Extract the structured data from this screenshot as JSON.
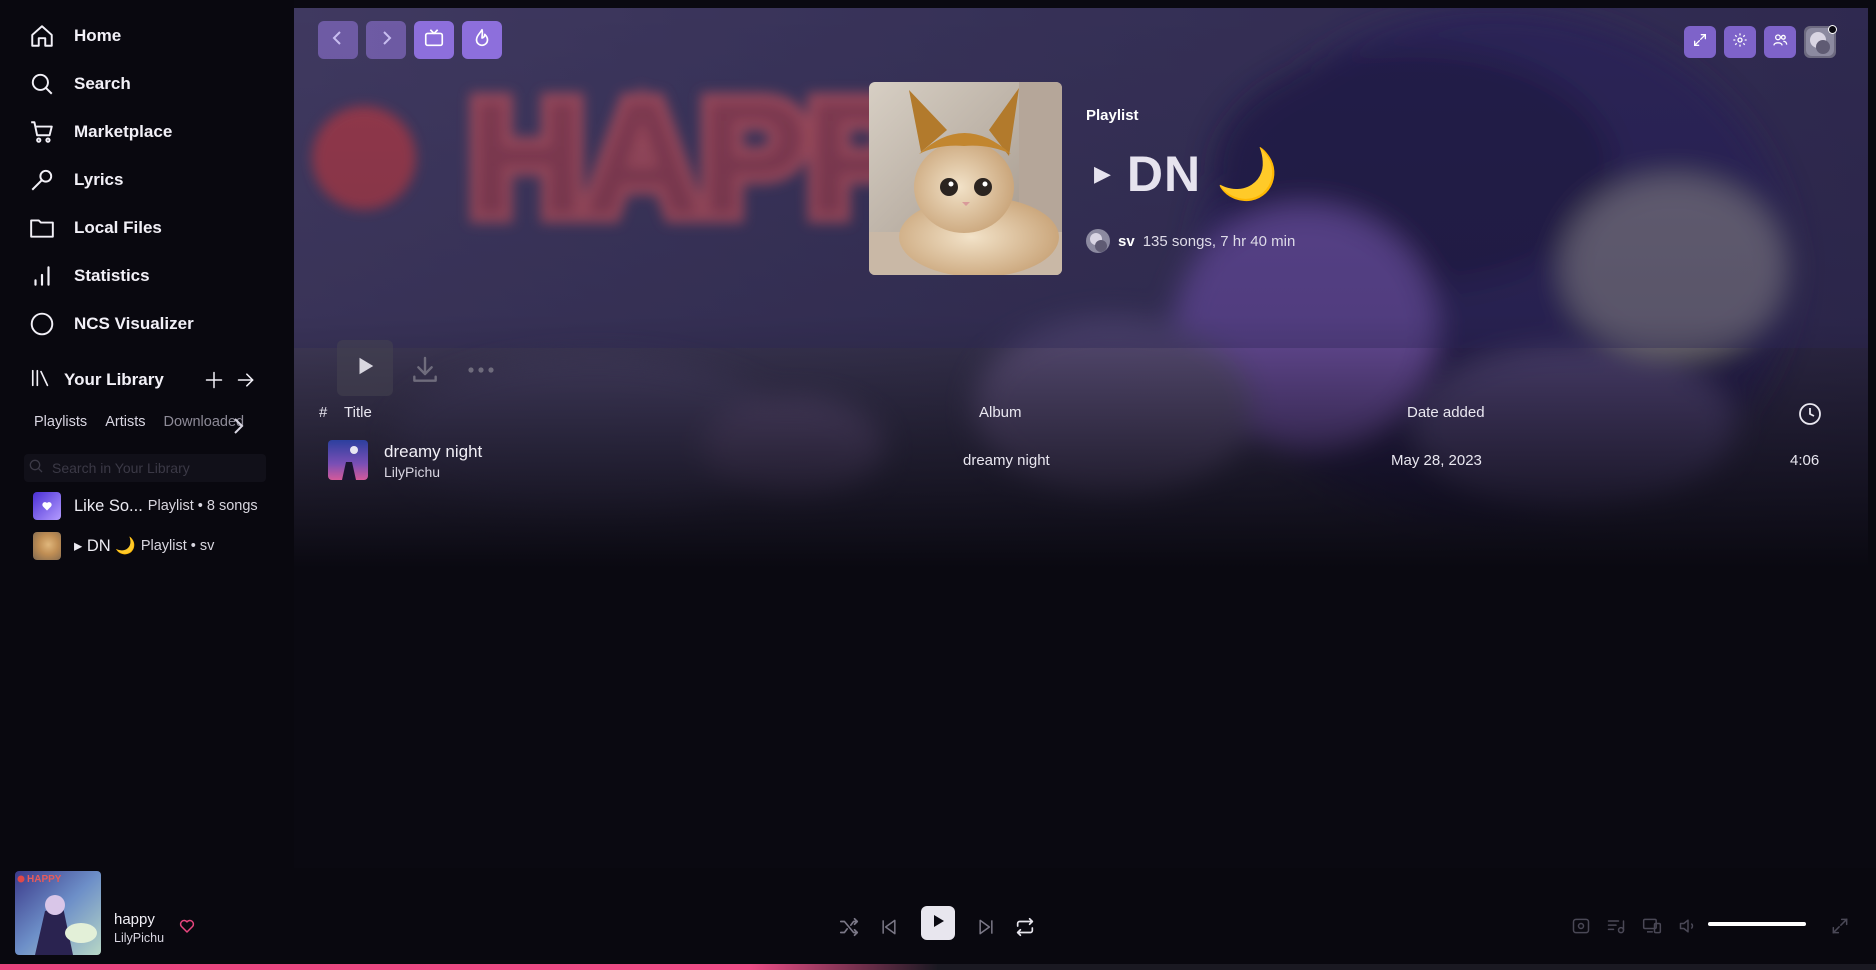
{
  "sidebar": {
    "nav": [
      {
        "label": "Home",
        "icon": "home-icon"
      },
      {
        "label": "Search",
        "icon": "search-icon"
      },
      {
        "label": "Marketplace",
        "icon": "cart-icon"
      },
      {
        "label": "Lyrics",
        "icon": "microphone-icon"
      },
      {
        "label": "Local Files",
        "icon": "folder-icon"
      },
      {
        "label": "Statistics",
        "icon": "bar-chart-icon"
      },
      {
        "label": "NCS Visualizer",
        "icon": "circle-icon"
      }
    ],
    "library": {
      "title": "Your Library",
      "chips": [
        "Playlists",
        "Artists",
        "Downloaded"
      ],
      "search_placeholder": "Search in Your Library",
      "items": [
        {
          "name": "Like So...",
          "meta": "Playlist • 8 songs"
        },
        {
          "name": "▸ DN 🌙",
          "meta": "Playlist • sv"
        }
      ]
    }
  },
  "header": {
    "type": "Playlist",
    "title": "DN 🌙",
    "title_marker": "▶",
    "owner": "sv",
    "stats": "135 songs, 7 hr 40 min"
  },
  "table": {
    "columns": {
      "index": "#",
      "title": "Title",
      "album": "Album",
      "date_added": "Date added"
    },
    "rows": [
      {
        "title": "dreamy night",
        "artist": "LilyPichu",
        "album": "dreamy night",
        "date_added": "May 28, 2023",
        "duration": "4:06"
      }
    ]
  },
  "player": {
    "now_playing": {
      "title": "happy",
      "artist": "LilyPichu",
      "art_text": "HAPPY"
    },
    "volume": 1.0,
    "progress": 0.5
  },
  "colors": {
    "accent": "#8d6fdc",
    "progress": "#e8457e",
    "heart": "#e8457e",
    "background": "#0a0911"
  }
}
